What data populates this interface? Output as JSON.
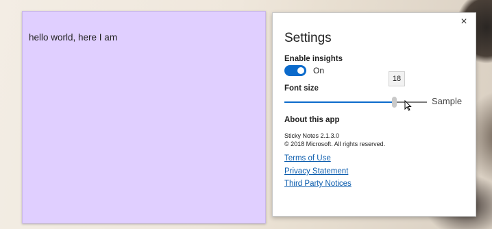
{
  "note": {
    "text": "hello world, here I am"
  },
  "settings": {
    "title": "Settings",
    "close_icon": "×",
    "insights": {
      "label": "Enable insights",
      "state_text": "On",
      "enabled": true
    },
    "font_size": {
      "label": "Font size",
      "value": "18",
      "fraction": 0.77,
      "sample": "Sample"
    },
    "about": {
      "label": "About this app",
      "version": "Sticky Notes  2.1.3.0",
      "copyright": "© 2018 Microsoft. All rights reserved."
    },
    "links": [
      "Terms of Use",
      "Privacy Statement",
      "Third Party Notices"
    ]
  },
  "colors": {
    "note": "#e0cfff",
    "accent": "#0b6acb",
    "link": "#0b5cad"
  }
}
